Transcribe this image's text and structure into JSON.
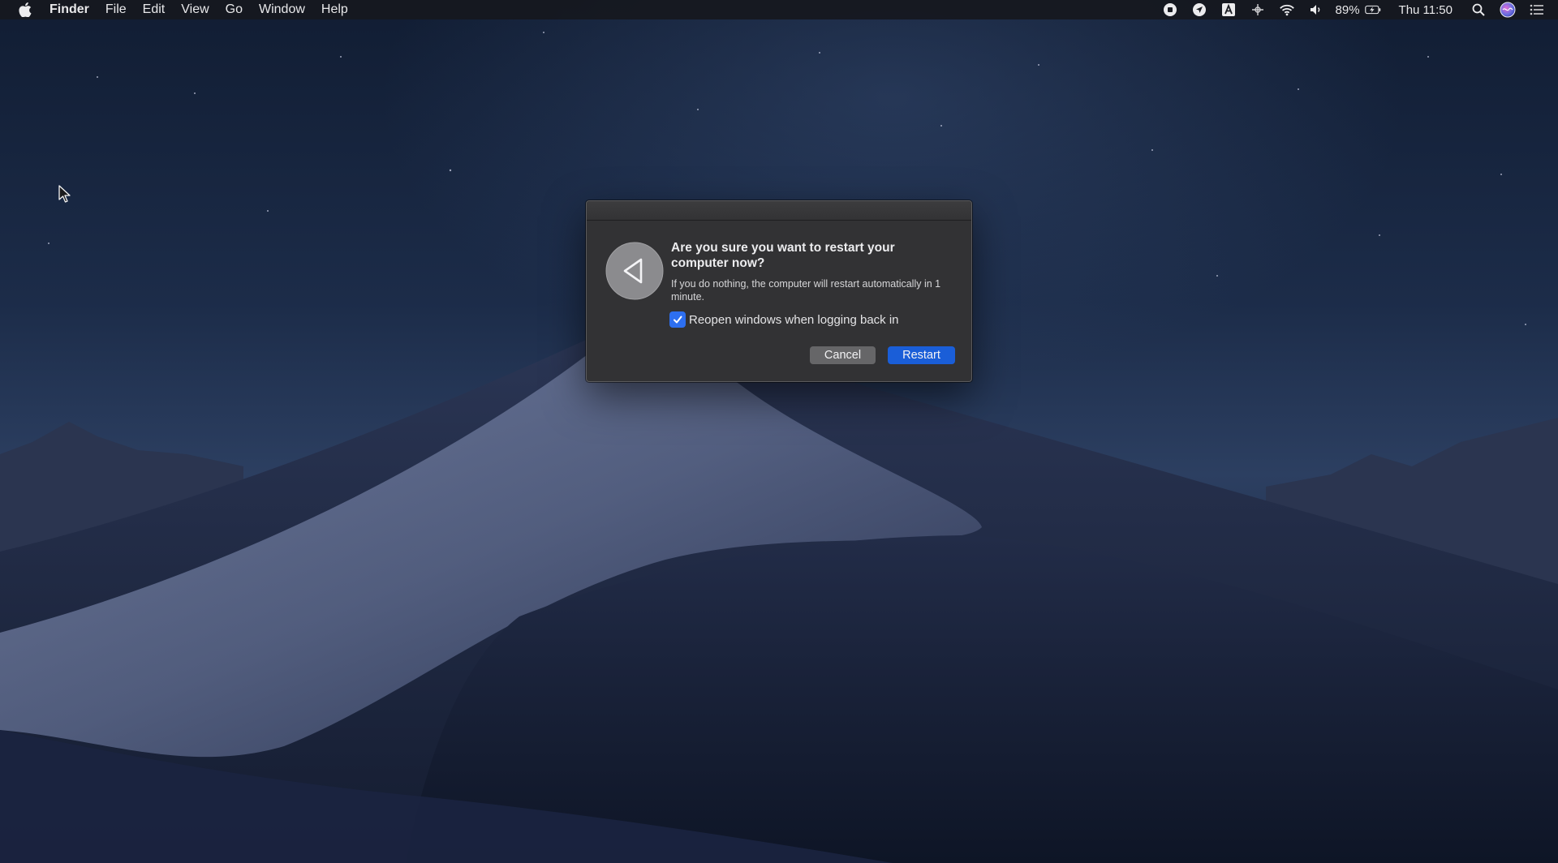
{
  "menubar": {
    "app_name": "Finder",
    "menus": [
      "File",
      "Edit",
      "View",
      "Go",
      "Window",
      "Help"
    ],
    "status_icons": [
      "record-icon",
      "location-icon",
      "input-source-icon",
      "scripts-icon",
      "wifi-icon",
      "volume-icon"
    ],
    "battery_percent": "89%",
    "clock": "Thu 11:50"
  },
  "dialog": {
    "title": "Are you sure you want to restart your computer now?",
    "message": "If you do nothing, the computer will restart automatically in 1 minute.",
    "checkbox_label": "Reopen windows when logging back in",
    "checkbox_checked": true,
    "cancel_label": "Cancel",
    "default_label": "Restart",
    "accent_color": "#1a5ed8"
  }
}
